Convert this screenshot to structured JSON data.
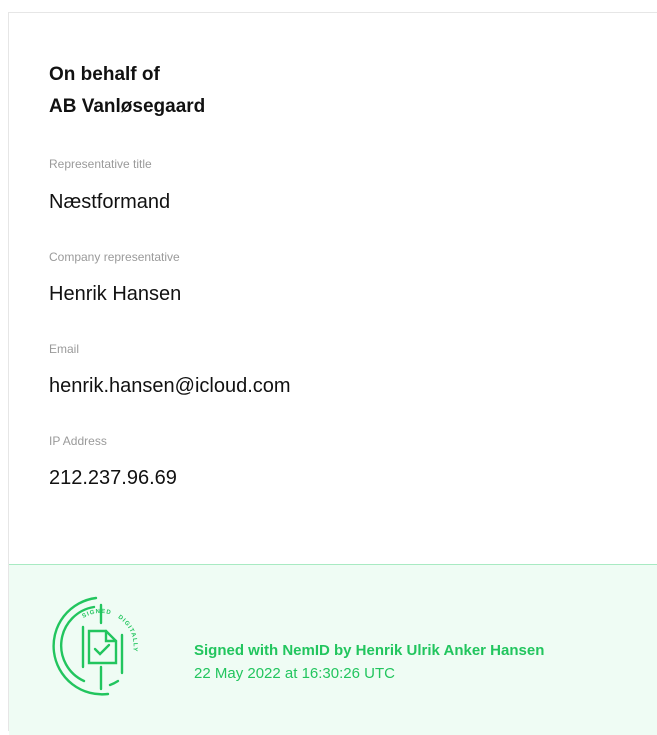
{
  "header": {
    "line1": "On behalf of",
    "line2": "AB Vanløsegaard"
  },
  "fields": [
    {
      "label": "Representative title",
      "value": "Næstformand"
    },
    {
      "label": "Company representative",
      "value": "Henrik Hansen"
    },
    {
      "label": "Email",
      "value": "henrik.hansen@icloud.com"
    },
    {
      "label": "IP Address",
      "value": "212.237.96.69"
    }
  ],
  "signature": {
    "title": "Signed with NemID by Henrik Ulrik Anker Hansen",
    "date": "22 May 2022 at 16:30:26 UTC",
    "seal_text_top": "SIGNED",
    "seal_text_right": "DIGITALLY",
    "seal_icon": "signed-digitally-seal-icon",
    "accent_color": "#22c55e",
    "panel_background": "#effcf4"
  }
}
